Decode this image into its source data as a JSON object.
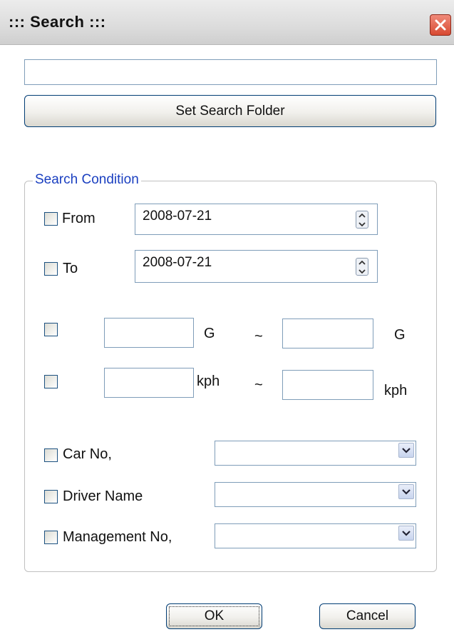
{
  "window": {
    "title": "::: Search :::"
  },
  "folder": {
    "path_value": "",
    "set_folder_label": "Set Search Folder"
  },
  "search_condition": {
    "group_label": "Search Condition",
    "from": {
      "label": "From",
      "value": "2008-07-21"
    },
    "to": {
      "label": "To",
      "value": "2008-07-21"
    },
    "g_force": {
      "unit_label": "G",
      "range_separator": "~",
      "min_value": "",
      "max_value": ""
    },
    "speed": {
      "unit_label": "kph",
      "range_separator": "~",
      "min_value": "",
      "max_value": ""
    },
    "car_no": {
      "label": "Car No,",
      "selected": ""
    },
    "driver_name": {
      "label": "Driver Name",
      "selected": ""
    },
    "management_no": {
      "label": "Management No,",
      "selected": ""
    }
  },
  "buttons": {
    "ok_label": "OK",
    "cancel_label": "Cancel"
  },
  "icons": {
    "close": "close-icon",
    "spin_up": "spin-up-icon",
    "spin_down": "spin-down-icon",
    "dropdown": "chevron-down-icon"
  },
  "colors": {
    "group_title": "#1a3fc0",
    "close_button": "#d84a32",
    "window_frame": "#0f3e46"
  }
}
